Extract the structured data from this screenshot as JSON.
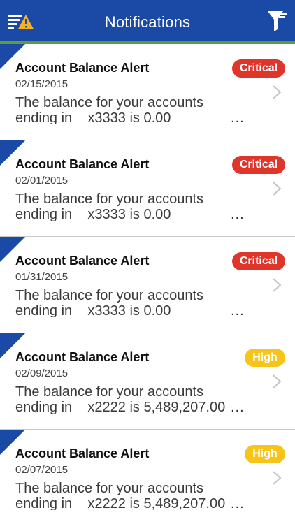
{
  "header": {
    "title": "Notifications",
    "left_icon": "sort-alert-icon",
    "right_icon": "filter-icon",
    "bar_color": "#1a4aa6",
    "stripe_color": "#5b9c3b"
  },
  "notifications": [
    {
      "title": "Account Balance Alert",
      "date": "02/15/2015",
      "badge": "Critical",
      "severity": "critical",
      "body_line1": "The balance for your accounts",
      "body_line2": "ending in    x3333 is 0.00",
      "more": "..."
    },
    {
      "title": "Account Balance Alert",
      "date": "02/01/2015",
      "badge": "Critical",
      "severity": "critical",
      "body_line1": "The balance for your accounts",
      "body_line2": "ending in    x3333 is 0.00",
      "more": "..."
    },
    {
      "title": "Account Balance Alert",
      "date": "01/31/2015",
      "badge": "Critical",
      "severity": "critical",
      "body_line1": "The balance for your accounts",
      "body_line2": "ending in    x3333 is 0.00",
      "more": "..."
    },
    {
      "title": "Account Balance Alert",
      "date": "02/09/2015",
      "badge": "High",
      "severity": "high",
      "body_line1": "The balance for your accounts",
      "body_line2": "ending in    x2222 is 5,489,207.00",
      "more": "..."
    },
    {
      "title": "Account Balance Alert",
      "date": "02/07/2015",
      "badge": "High",
      "severity": "high",
      "body_line1": "The balance for your accounts",
      "body_line2": "ending in    x2222 is 5,489,207.00",
      "more": "..."
    }
  ],
  "colors": {
    "critical": "#e0352b",
    "high": "#f7c41a",
    "accent": "#1a4aa6"
  }
}
